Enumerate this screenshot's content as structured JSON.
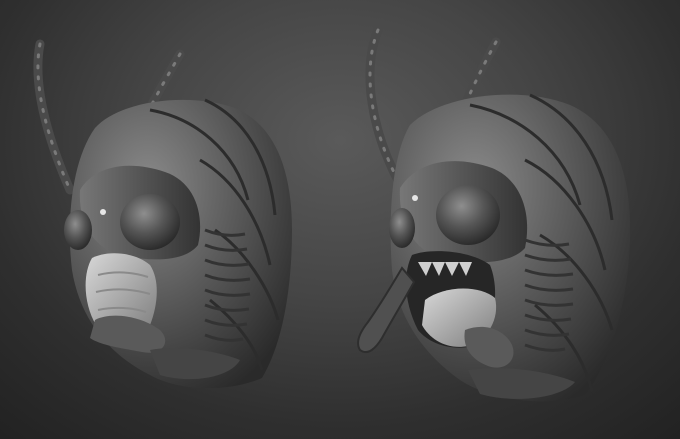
{
  "scene": {
    "background_top": "#5a5a5a",
    "background_bottom": "#202020",
    "clay_color": "#6b6b6b",
    "models": [
      {
        "pose": "mouth-closed"
      },
      {
        "pose": "mouth-open"
      }
    ]
  }
}
